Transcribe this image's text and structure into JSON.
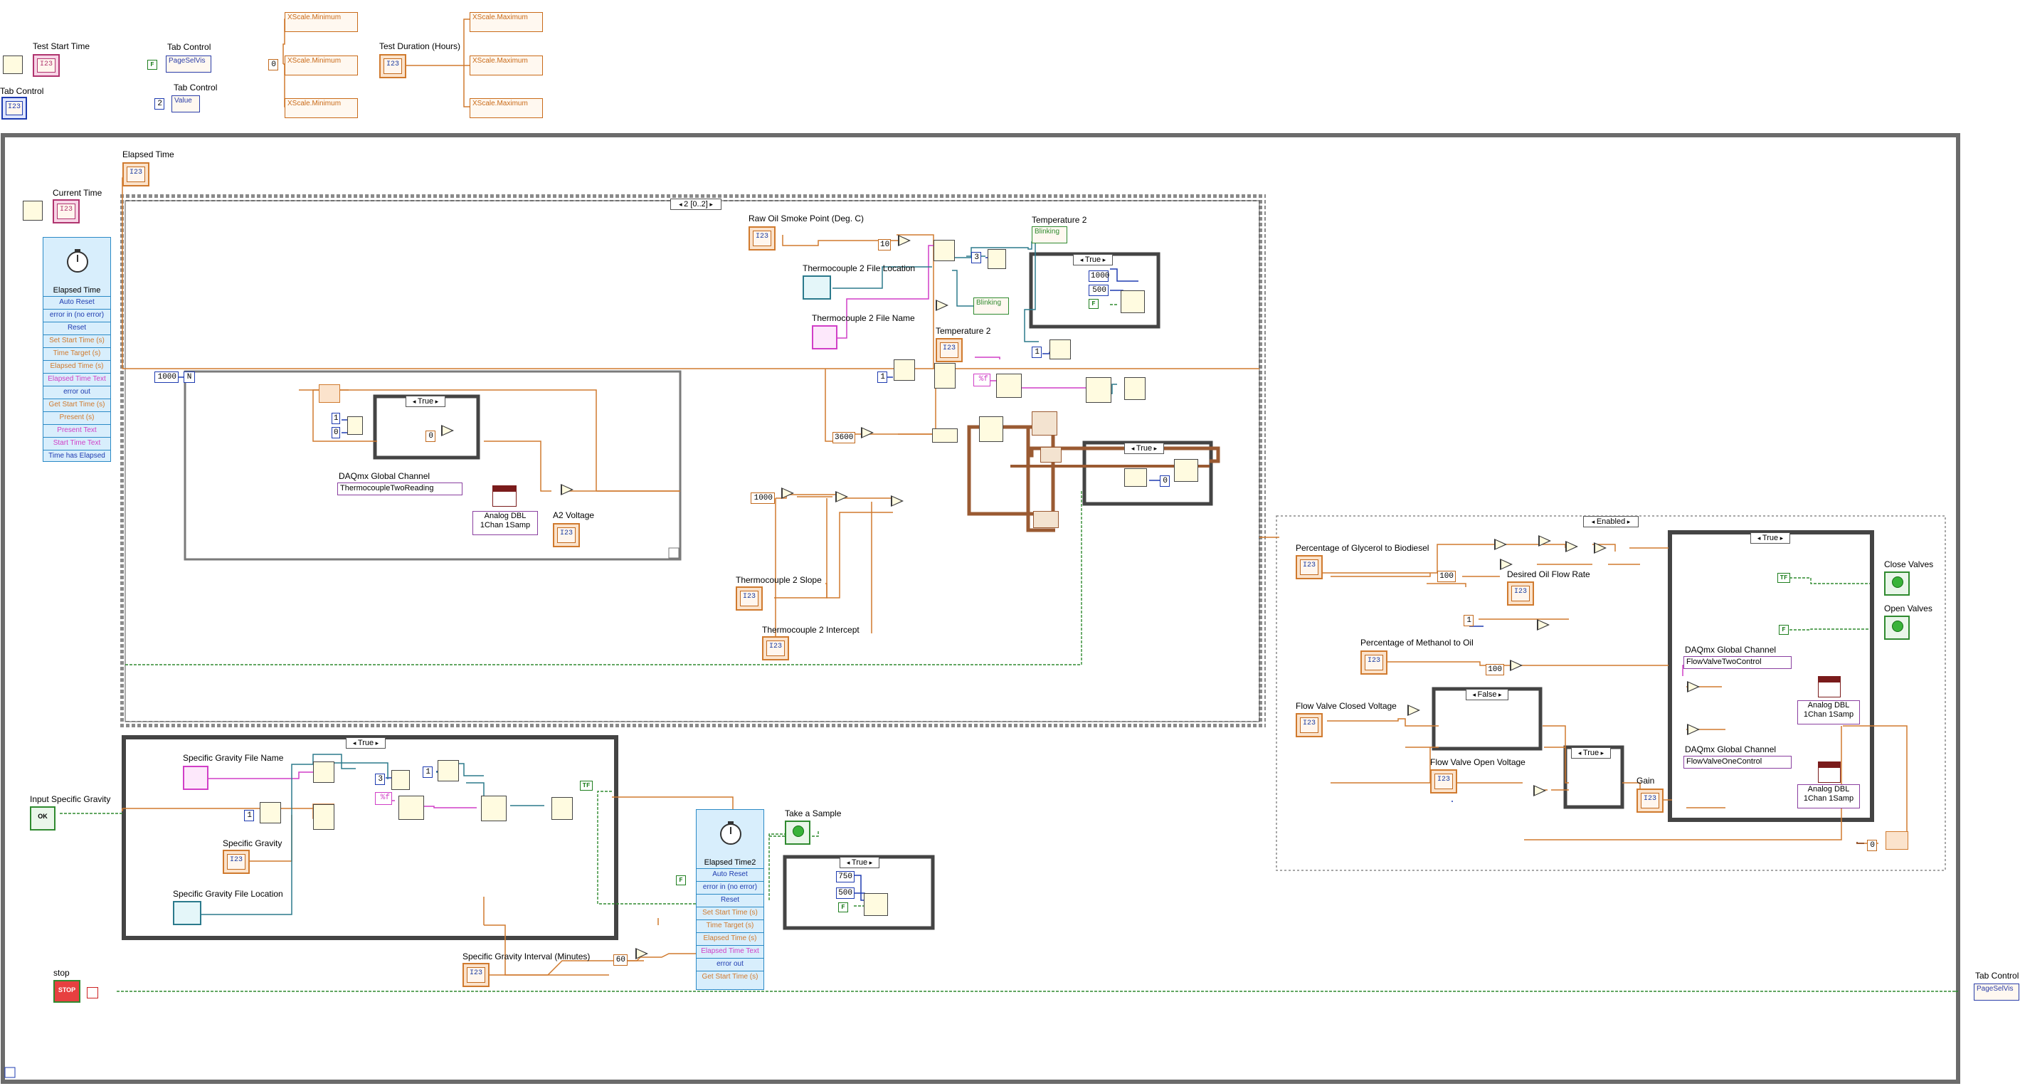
{
  "labels": {
    "test_start_time": "Test Start Time",
    "tab_control_1": "Tab Control",
    "tab_control_2": "Tab Control",
    "tab_control_3": "Tab Control",
    "tab_control_left": "Tab Control",
    "test_duration": "Test Duration (Hours)",
    "elapsed_time_top": "Elapsed Time",
    "current_time": "Current Time",
    "raw_oil": "Raw Oil Smoke Point (Deg. C)",
    "temperature2_a": "Temperature 2",
    "temperature2_b": "Temperature 2",
    "tc2_file_location": "Thermocouple 2 File Location",
    "tc2_file_name": "Thermocouple 2 File Name",
    "daqmx_global_channel": "DAQmx Global Channel",
    "a2_voltage": "A2 Voltage",
    "tc2_slope": "Thermocouple 2 Slope",
    "tc2_intercept": "Thermocouple 2 Intercept",
    "sg_file_name": "Specific Gravity File Name",
    "specific_gravity": "Specific Gravity",
    "sg_file_location": "Specific Gravity File Location",
    "input_sg": "Input Specific Gravity",
    "take_sample": "Take  a Sample",
    "sg_interval": "Specific Gravity Interval (Minutes)",
    "stop": "stop",
    "pct_glycerol": "Percentage of Glycerol to Biodiesel",
    "desired_oil_flow": "Desired Oil Flow Rate",
    "pct_methanol": "Percentage of Methanol to Oil",
    "flow_closed": "Flow Valve Closed Voltage",
    "flow_open": "Flow Valve Open Voltage",
    "gain": "Gain",
    "close_valves": "Close Valves",
    "open_valves": "Open Valves",
    "daqmx_ch2": "DAQmx Global Channel",
    "daqmx_ch1": "DAQmx Global Channel"
  },
  "property_nodes": {
    "pagesel_1": "PageSelVis",
    "value": "Value",
    "xmin_1": "XScale.Minimum",
    "xmin_2": "XScale.Minimum",
    "xmin_3": "XScale.Minimum",
    "xmax_1": "XScale.Maximum",
    "xmax_2": "XScale.Maximum",
    "xmax_3": "XScale.Maximum",
    "blinking_1": "Blinking",
    "blinking_2": "Blinking",
    "pagesel_right": "PageSelVis"
  },
  "constants": {
    "f_top": "F",
    "two": "2",
    "zero_top": "0",
    "n_1000": "1000",
    "n_10": "10",
    "n_3a": "3",
    "n_1a": "1",
    "n_3600": "3600",
    "n_1000b": "1000",
    "n_500": "500",
    "f_case": "F",
    "n_1b": "1",
    "n_0b": "0",
    "n_1c": "1",
    "n_0c": "0",
    "n_1000c": "1000",
    "fmt_pct_f": "%f",
    "fmt_pct_f2": "%f",
    "n_3b": "3",
    "n_1d": "1",
    "n_1e": "1",
    "tf_sg": "TF",
    "f_sg": "F",
    "n_60": "60",
    "n_750": "750",
    "n_500b": "500",
    "f_sample": "F",
    "n_100a": "100",
    "n_1f": "1",
    "n_100b": "100",
    "tf_close": "TF",
    "f_open": "F",
    "n_0d": "0",
    "n_0e": "0",
    "i_loop": "i",
    "n_loop": "N"
  },
  "structures": {
    "seq_selector": "2 [0..2]",
    "case_true_1": "True",
    "case_true_2": "True",
    "case_true_3": "True",
    "case_true_sg": "True",
    "case_true_sample": "True",
    "disabled_selector": "Enabled",
    "case_false": "False",
    "case_true_small": "True",
    "case_true_right": "True"
  },
  "express_vi_1": {
    "title": "Elapsed Time",
    "rows": [
      "Auto Reset",
      "error in (no error)",
      "Reset",
      "Set Start Time (s)",
      "Time Target (s)",
      "Elapsed Time (s)",
      "Elapsed Time Text",
      "error out",
      "Get Start Time (s)",
      "Present (s)",
      "Present Text",
      "Start Time Text",
      "Time has Elapsed"
    ]
  },
  "express_vi_2": {
    "title": "Elapsed Time2",
    "rows": [
      "Auto Reset",
      "error in (no error)",
      "Reset",
      "Set Start Time (s)",
      "Time Target (s)",
      "Elapsed Time (s)",
      "Elapsed Time Text",
      "error out",
      "Get Start Time (s)"
    ]
  },
  "daq": {
    "channel_tc": "ThermocoupleTwoReading",
    "poly_tc": "Analog DBL\n1Chan 1Samp",
    "channel_flow2": "FlowValveTwoControl",
    "poly_flow2": "Analog DBL\n1Chan 1Samp",
    "channel_flow1": "FlowValveOneControl",
    "poly_flow1": "Analog DBL\n1Chan 1Samp"
  },
  "terminals": {
    "dbl": "I23",
    "bool_ok": "OK",
    "stop_btn": "STOP",
    "path": "Path",
    "abc": "abc"
  },
  "colors": {
    "dbl_wire": "#d07a2e",
    "int_wire": "#1e3bb0",
    "bool_wire": "#2f8a2f",
    "string_wire": "#d13fc7",
    "path_wire": "#2b7a8c",
    "cluster_wire": "#9a5a32",
    "structure_border": "#555555"
  }
}
